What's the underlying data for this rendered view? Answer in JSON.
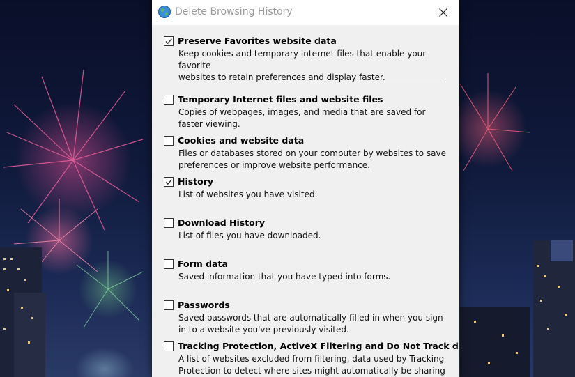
{
  "window": {
    "title": "Delete Browsing History",
    "app_icon": "ie-globe-icon",
    "close_icon": "close-icon"
  },
  "options": [
    {
      "title": "Preserve Favorites website data",
      "checked": true,
      "lines": [
        "Keep cookies and temporary Internet files that enable your favorite",
        "websites to retain preferences and display faster."
      ]
    },
    {
      "title": "Temporary Internet files and website files",
      "checked": false,
      "lines": [
        "Copies of webpages, images, and media that are saved for",
        "faster viewing."
      ]
    },
    {
      "title": "Cookies and website data",
      "checked": false,
      "lines": [
        "Files or databases stored on your computer by websites to save",
        "preferences or improve website performance."
      ]
    },
    {
      "title": "History",
      "checked": true,
      "lines": [
        "List of websites you have visited."
      ]
    },
    {
      "title": "Download History",
      "checked": false,
      "lines": [
        "List of files you have downloaded."
      ]
    },
    {
      "title": "Form data",
      "checked": false,
      "lines": [
        "Saved information that you have typed into forms."
      ]
    },
    {
      "title": "Passwords",
      "checked": false,
      "lines": [
        "Saved passwords that are automatically filled in when you sign",
        "in to a website you've previously visited."
      ]
    },
    {
      "title": "Tracking Protection, ActiveX Filtering and Do Not Track d",
      "checked": false,
      "lines": [
        "A list of websites excluded from filtering, data used by Tracking",
        "Protection to detect where sites might automatically be sharing details"
      ]
    }
  ],
  "colors": {
    "dialog_bg": "#f0f0f0",
    "titlebar_bg": "#ffffff",
    "title_text": "#9a9a9a"
  }
}
